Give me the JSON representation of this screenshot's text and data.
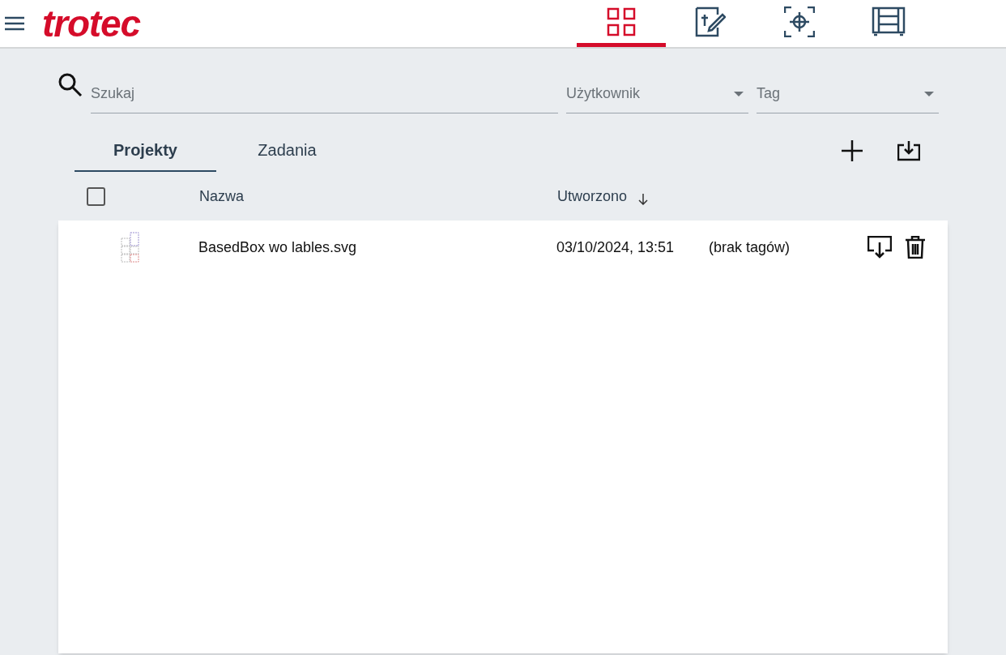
{
  "header": {
    "logo": "trotec",
    "nav": [
      {
        "kind": "grid",
        "selected": true
      },
      {
        "kind": "design",
        "selected": false
      },
      {
        "kind": "target",
        "selected": false
      },
      {
        "kind": "machine",
        "selected": false
      }
    ]
  },
  "filters": {
    "search": {
      "placeholder": "Szukaj"
    },
    "user": {
      "placeholder": "Użytkownik"
    },
    "tag": {
      "placeholder": "Tag"
    }
  },
  "tabs": [
    {
      "label": "Projekty",
      "selected": true
    },
    {
      "label": "Zadania",
      "selected": false
    }
  ],
  "table": {
    "select_all": {
      "checked": false
    },
    "columns": [
      "Nazwa",
      "Utworzono"
    ],
    "rows": [
      {
        "name": "BasedBox wo lables.svg",
        "created": "03/10/2024, 13:51",
        "tags": "(brak tagów)"
      }
    ]
  }
}
